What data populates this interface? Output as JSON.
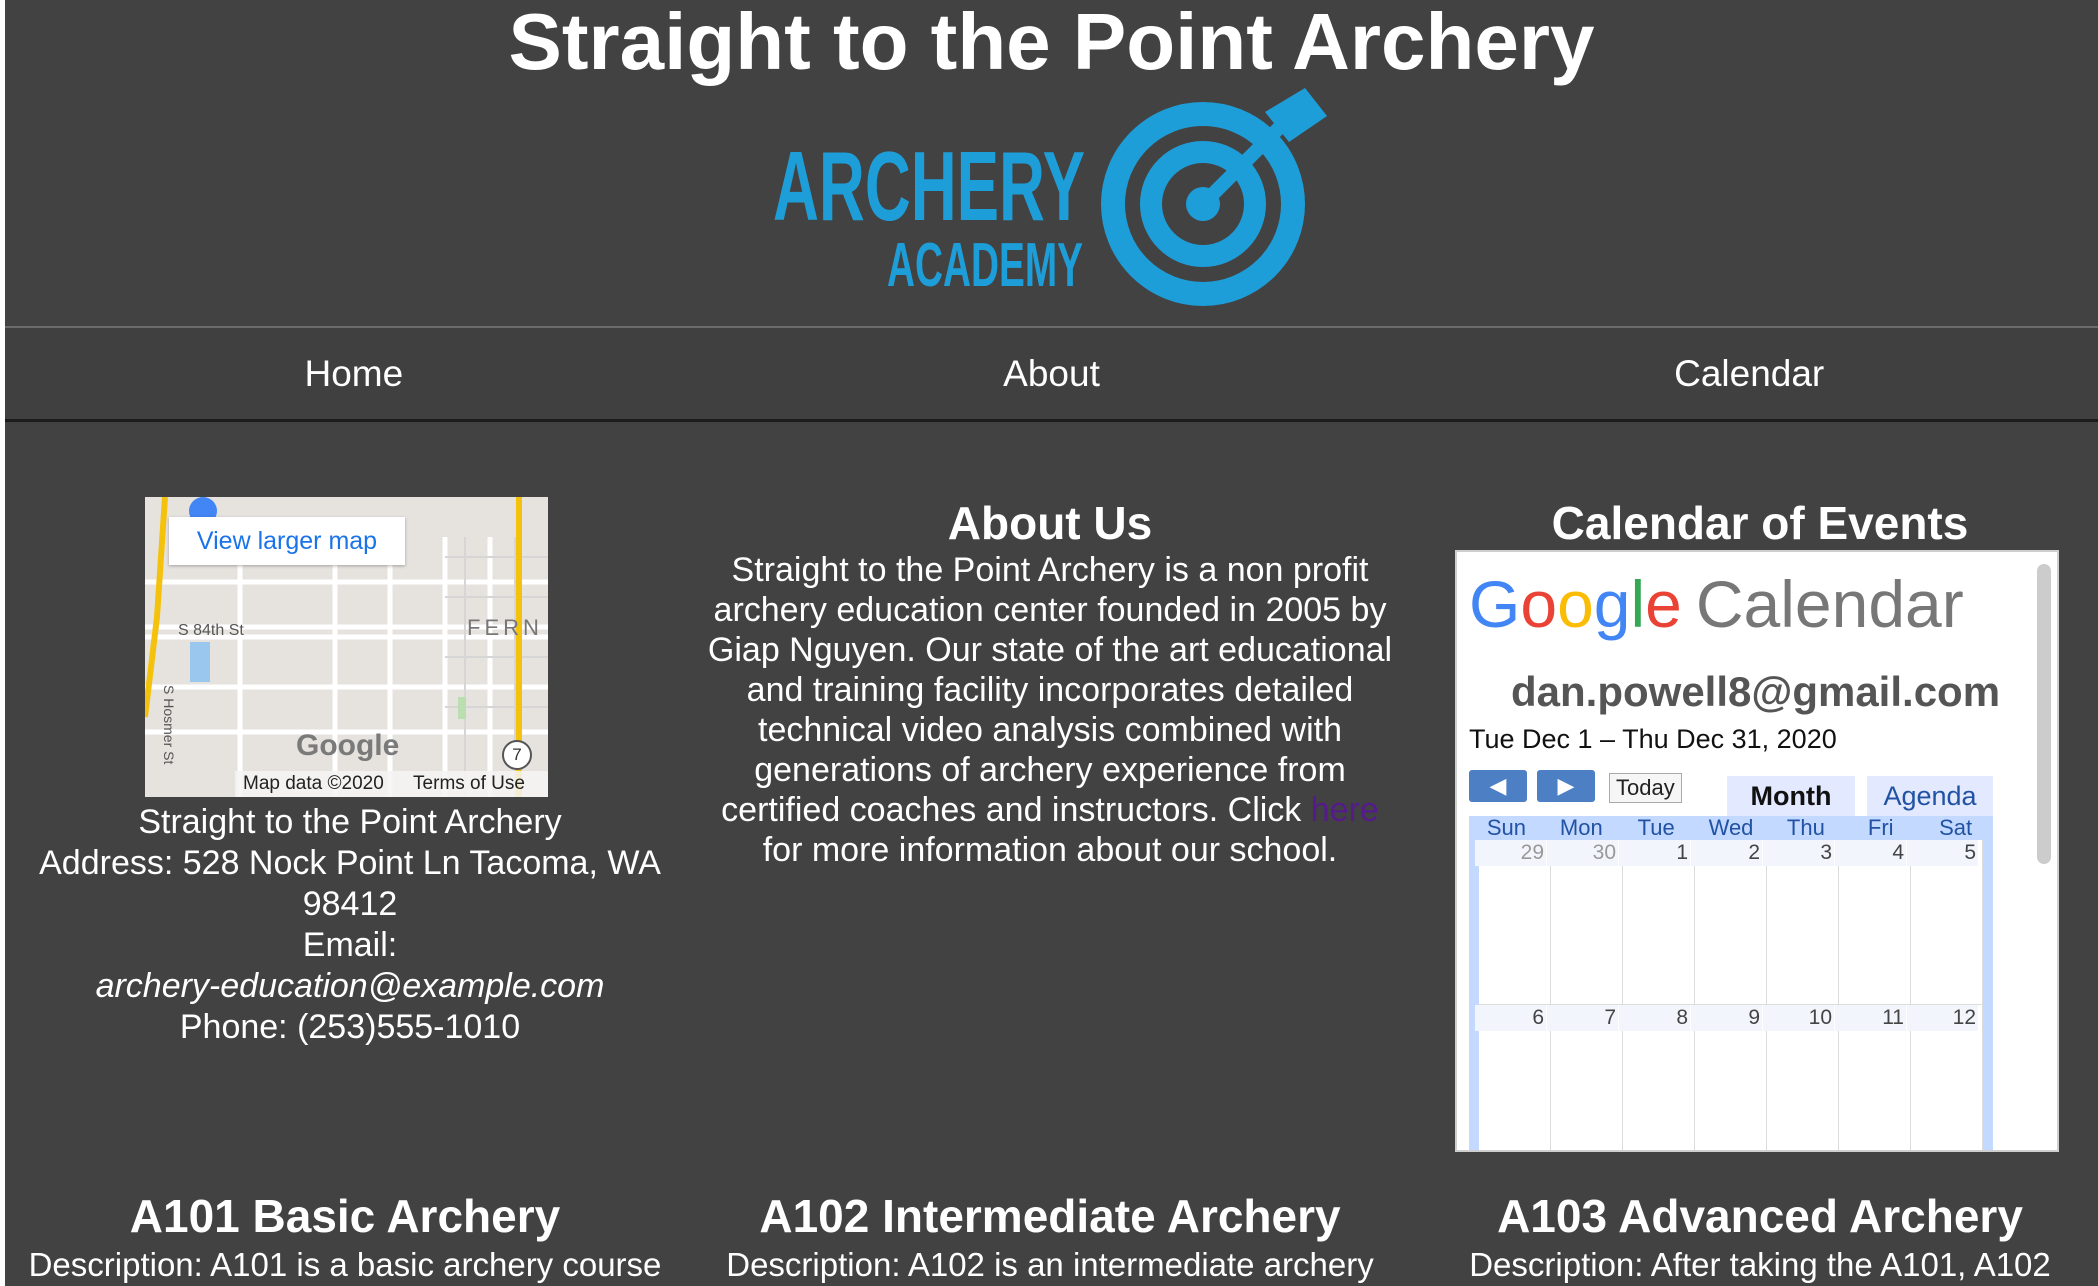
{
  "site": {
    "title": "Straight to the Point Archery",
    "logo_text_main": "ARCHERY",
    "logo_text_sub": "ACADEMY",
    "logo_color": "#1e9ed8",
    "background": "#424242"
  },
  "nav": {
    "items": [
      {
        "label": "Home"
      },
      {
        "label": "About"
      },
      {
        "label": "Calendar"
      }
    ]
  },
  "map": {
    "link_label": "View larger map",
    "street_1": "S 84th St",
    "street_2": "S Hosmer St",
    "area_label": "FERN",
    "route_number": "7",
    "brand": "Google",
    "attribution": "Map data ©2020",
    "terms": "Terms of Use"
  },
  "contact": {
    "name": "Straight to the Point Archery",
    "address": "Address: 528 Nock Point Ln Tacoma, WA 98412",
    "email_label": "Email:",
    "email": "archery-education@example.com",
    "phone": "Phone: (253)555-1010"
  },
  "about": {
    "heading": "About Us",
    "text": "Straight to the Point Archery is a non profit archery education center founded in 2005 by Giap Nguyen. Our state of the art educational and training facility incorporates detailed technical video analysis combined with generations of archery experience from certified coaches and instructors. Click",
    "link": "here",
    "text_after": "for more information about our school."
  },
  "calendar": {
    "heading": "Calendar of Events",
    "logo_word": "Calendar",
    "owner": "dan.powell8@gmail.com",
    "range": "Tue Dec 1 – Thu Dec 31, 2020",
    "today_label": "Today",
    "tab_month": "Month",
    "tab_agenda": "Agenda",
    "weekdays": [
      "Sun",
      "Mon",
      "Tue",
      "Wed",
      "Thu",
      "Fri",
      "Sat"
    ],
    "weeks": [
      [
        "29",
        "30",
        "1",
        "2",
        "3",
        "4",
        "5"
      ],
      [
        "6",
        "7",
        "8",
        "9",
        "10",
        "11",
        "12"
      ]
    ]
  },
  "courses": [
    {
      "title": "A101 Basic Archery",
      "description": "Description: A101 is a basic archery course"
    },
    {
      "title": "A102 Intermediate Archery",
      "description": "Description: A102 is an intermediate archery"
    },
    {
      "title": "A103 Advanced Archery",
      "description": "Description: After taking the A101, A102"
    }
  ]
}
